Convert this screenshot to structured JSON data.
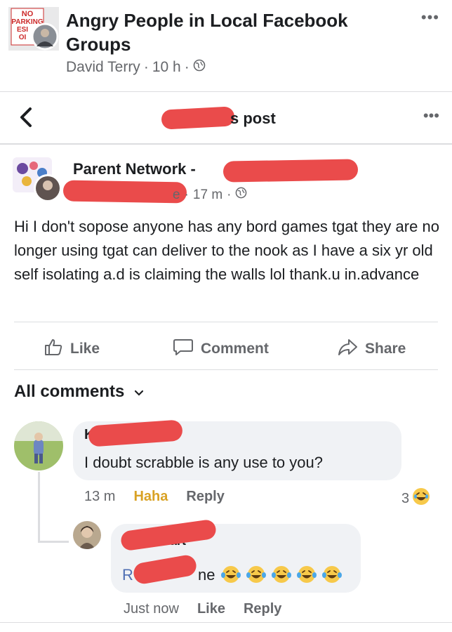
{
  "group": {
    "title": "Angry People in Local Facebook Groups",
    "poster": "David Terry",
    "time": "10 h",
    "privacy_icon": "globe-icon",
    "avatar_sign_lines": [
      "NO",
      "PARKING",
      "ESI",
      "OI"
    ]
  },
  "nav": {
    "back_icon": "chevron-left-icon",
    "title": "s post",
    "more_icon": "more-dots-icon"
  },
  "post": {
    "author": "Parent Network -",
    "time": "17 m",
    "author_fragment": "e",
    "body": "Hi I don't sopose anyone has any bord games tgat they are no longer using tgat can deliver to the nook as I have a six yr old self isolating a.d is claiming the walls lol  thank.u in.advance"
  },
  "actions": {
    "like": "Like",
    "comment": "Comment",
    "share": "Share"
  },
  "comments_header": "All comments",
  "comments": [
    {
      "name_fragment": "K",
      "text": "I doubt scrabble is any use to you?",
      "time": "13 m",
      "reaction_link": "Haha",
      "reply": "Reply",
      "reaction_count": "3"
    },
    {
      "name_fragment": "art",
      "text_fragment_start": "R",
      "text_fragment_end": "ne",
      "emoji_count": 5,
      "time": "Just now",
      "like": "Like",
      "reply": "Reply"
    }
  ],
  "colors": {
    "redaction": "#ea4b4b",
    "meta_gray": "#65676b",
    "haha": "#d9a225",
    "bubble": "#f0f2f5"
  }
}
